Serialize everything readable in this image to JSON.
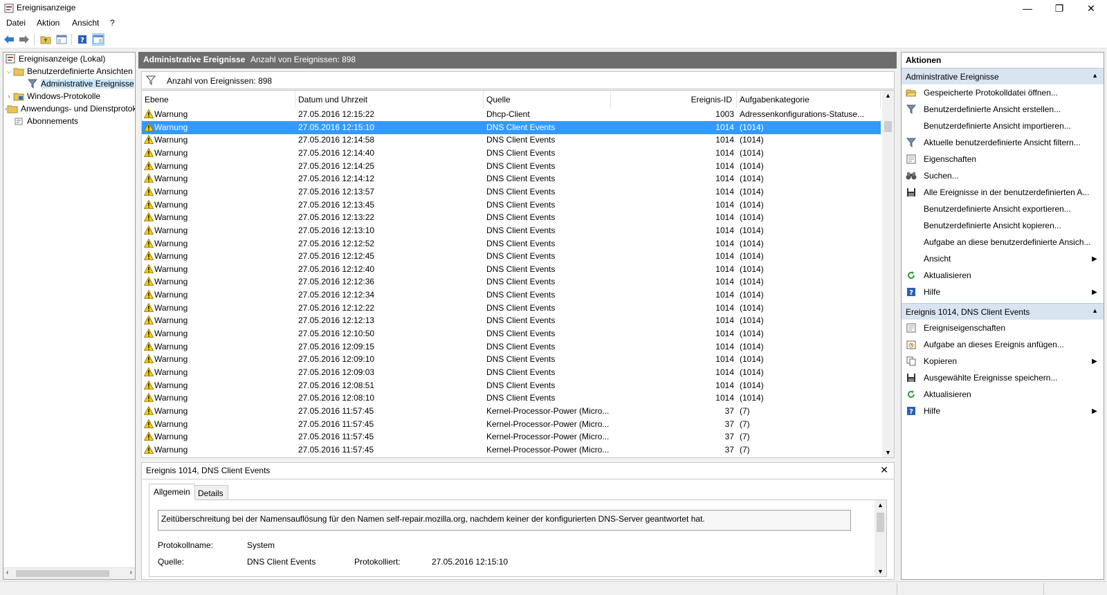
{
  "window": {
    "title": "Ereignisanzeige",
    "minimize": "—",
    "maximize": "❐",
    "close": "✕"
  },
  "menu": [
    "Datei",
    "Aktion",
    "Ansicht",
    "?"
  ],
  "tree": {
    "root": "Ereignisanzeige (Lokal)",
    "custom_views": "Benutzerdefinierte Ansichten",
    "admin_events": "Administrative Ereignisse",
    "windows_logs": "Windows-Protokolle",
    "app_logs": "Anwendungs- und Dienstprotokolle",
    "subscriptions": "Abonnements"
  },
  "center": {
    "header_title": "Administrative Ereignisse",
    "header_count": "Anzahl von Ereignissen: 898",
    "filter_text": "Anzahl von Ereignissen: 898",
    "columns": [
      "Ebene",
      "Datum und Uhrzeit",
      "Quelle",
      "Ereignis-ID",
      "Aufgabenkategorie"
    ],
    "rows": [
      {
        "level": "Warnung",
        "date": "27.05.2016 12:15:22",
        "source": "Dhcp-Client",
        "id": "1003",
        "cat": "Adressenkonfigurations-Statuse..."
      },
      {
        "level": "Warnung",
        "date": "27.05.2016 12:15:10",
        "source": "DNS Client Events",
        "id": "1014",
        "cat": "(1014)"
      },
      {
        "level": "Warnung",
        "date": "27.05.2016 12:14:58",
        "source": "DNS Client Events",
        "id": "1014",
        "cat": "(1014)"
      },
      {
        "level": "Warnung",
        "date": "27.05.2016 12:14:40",
        "source": "DNS Client Events",
        "id": "1014",
        "cat": "(1014)"
      },
      {
        "level": "Warnung",
        "date": "27.05.2016 12:14:25",
        "source": "DNS Client Events",
        "id": "1014",
        "cat": "(1014)"
      },
      {
        "level": "Warnung",
        "date": "27.05.2016 12:14:12",
        "source": "DNS Client Events",
        "id": "1014",
        "cat": "(1014)"
      },
      {
        "level": "Warnung",
        "date": "27.05.2016 12:13:57",
        "source": "DNS Client Events",
        "id": "1014",
        "cat": "(1014)"
      },
      {
        "level": "Warnung",
        "date": "27.05.2016 12:13:45",
        "source": "DNS Client Events",
        "id": "1014",
        "cat": "(1014)"
      },
      {
        "level": "Warnung",
        "date": "27.05.2016 12:13:22",
        "source": "DNS Client Events",
        "id": "1014",
        "cat": "(1014)"
      },
      {
        "level": "Warnung",
        "date": "27.05.2016 12:13:10",
        "source": "DNS Client Events",
        "id": "1014",
        "cat": "(1014)"
      },
      {
        "level": "Warnung",
        "date": "27.05.2016 12:12:52",
        "source": "DNS Client Events",
        "id": "1014",
        "cat": "(1014)"
      },
      {
        "level": "Warnung",
        "date": "27.05.2016 12:12:45",
        "source": "DNS Client Events",
        "id": "1014",
        "cat": "(1014)"
      },
      {
        "level": "Warnung",
        "date": "27.05.2016 12:12:40",
        "source": "DNS Client Events",
        "id": "1014",
        "cat": "(1014)"
      },
      {
        "level": "Warnung",
        "date": "27.05.2016 12:12:36",
        "source": "DNS Client Events",
        "id": "1014",
        "cat": "(1014)"
      },
      {
        "level": "Warnung",
        "date": "27.05.2016 12:12:34",
        "source": "DNS Client Events",
        "id": "1014",
        "cat": "(1014)"
      },
      {
        "level": "Warnung",
        "date": "27.05.2016 12:12:22",
        "source": "DNS Client Events",
        "id": "1014",
        "cat": "(1014)"
      },
      {
        "level": "Warnung",
        "date": "27.05.2016 12:12:13",
        "source": "DNS Client Events",
        "id": "1014",
        "cat": "(1014)"
      },
      {
        "level": "Warnung",
        "date": "27.05.2016 12:10:50",
        "source": "DNS Client Events",
        "id": "1014",
        "cat": "(1014)"
      },
      {
        "level": "Warnung",
        "date": "27.05.2016 12:09:15",
        "source": "DNS Client Events",
        "id": "1014",
        "cat": "(1014)"
      },
      {
        "level": "Warnung",
        "date": "27.05.2016 12:09:10",
        "source": "DNS Client Events",
        "id": "1014",
        "cat": "(1014)"
      },
      {
        "level": "Warnung",
        "date": "27.05.2016 12:09:03",
        "source": "DNS Client Events",
        "id": "1014",
        "cat": "(1014)"
      },
      {
        "level": "Warnung",
        "date": "27.05.2016 12:08:51",
        "source": "DNS Client Events",
        "id": "1014",
        "cat": "(1014)"
      },
      {
        "level": "Warnung",
        "date": "27.05.2016 12:08:10",
        "source": "DNS Client Events",
        "id": "1014",
        "cat": "(1014)"
      },
      {
        "level": "Warnung",
        "date": "27.05.2016 11:57:45",
        "source": "Kernel-Processor-Power (Micro...",
        "id": "37",
        "cat": "(7)"
      },
      {
        "level": "Warnung",
        "date": "27.05.2016 11:57:45",
        "source": "Kernel-Processor-Power (Micro...",
        "id": "37",
        "cat": "(7)"
      },
      {
        "level": "Warnung",
        "date": "27.05.2016 11:57:45",
        "source": "Kernel-Processor-Power (Micro...",
        "id": "37",
        "cat": "(7)"
      },
      {
        "level": "Warnung",
        "date": "27.05.2016 11:57:45",
        "source": "Kernel-Processor-Power (Micro...",
        "id": "37",
        "cat": "(7)"
      }
    ],
    "selected_row": 1
  },
  "detail": {
    "title": "Ereignis 1014, DNS Client Events",
    "tab_general": "Allgemein",
    "tab_details": "Details",
    "message": "Zeitüberschreitung bei der Namensauflösung für den Namen self-repair.mozilla.org, nachdem keiner der konfigurierten DNS-Server geantwortet hat.",
    "log_label": "Protokollname:",
    "log_value": "System",
    "source_label": "Quelle:",
    "source_value": "DNS Client Events",
    "logged_label": "Protokolliert:",
    "logged_value": "27.05.2016 12:15:10"
  },
  "actions": {
    "title": "Aktionen",
    "section1": "Administrative Ereignisse",
    "section1_items": [
      {
        "label": "Gespeicherte Protokolldatei öffnen...",
        "icon": "folder-open-icon",
        "submenu": false
      },
      {
        "label": "Benutzerdefinierte Ansicht erstellen...",
        "icon": "filter-icon",
        "submenu": false
      },
      {
        "label": "Benutzerdefinierte Ansicht importieren...",
        "icon": "",
        "submenu": false
      },
      {
        "label": "Aktuelle benutzerdefinierte Ansicht filtern...",
        "icon": "filter-icon",
        "submenu": false
      },
      {
        "label": "Eigenschaften",
        "icon": "properties-icon",
        "submenu": false
      },
      {
        "label": "Suchen...",
        "icon": "binoculars-icon",
        "submenu": false
      },
      {
        "label": "Alle Ereignisse in der benutzerdefinierten A...",
        "icon": "save-icon",
        "submenu": false
      },
      {
        "label": "Benutzerdefinierte Ansicht exportieren...",
        "icon": "",
        "submenu": false
      },
      {
        "label": "Benutzerdefinierte Ansicht kopieren...",
        "icon": "",
        "submenu": false
      },
      {
        "label": "Aufgabe an diese benutzerdefinierte Ansich...",
        "icon": "",
        "submenu": false
      },
      {
        "label": "Ansicht",
        "icon": "",
        "submenu": true
      },
      {
        "label": "Aktualisieren",
        "icon": "refresh-icon",
        "submenu": false
      },
      {
        "label": "Hilfe",
        "icon": "help-icon",
        "submenu": true
      }
    ],
    "section2": "Ereignis 1014, DNS Client Events",
    "section2_items": [
      {
        "label": "Ereigniseigenschaften",
        "icon": "properties-icon",
        "submenu": false
      },
      {
        "label": "Aufgabe an dieses Ereignis anfügen...",
        "icon": "task-icon",
        "submenu": false
      },
      {
        "label": "Kopieren",
        "icon": "copy-icon",
        "submenu": true
      },
      {
        "label": "Ausgewählte Ereignisse speichern...",
        "icon": "save-icon",
        "submenu": false
      },
      {
        "label": "Aktualisieren",
        "icon": "refresh-icon",
        "submenu": false
      },
      {
        "label": "Hilfe",
        "icon": "help-icon",
        "submenu": true
      }
    ]
  }
}
